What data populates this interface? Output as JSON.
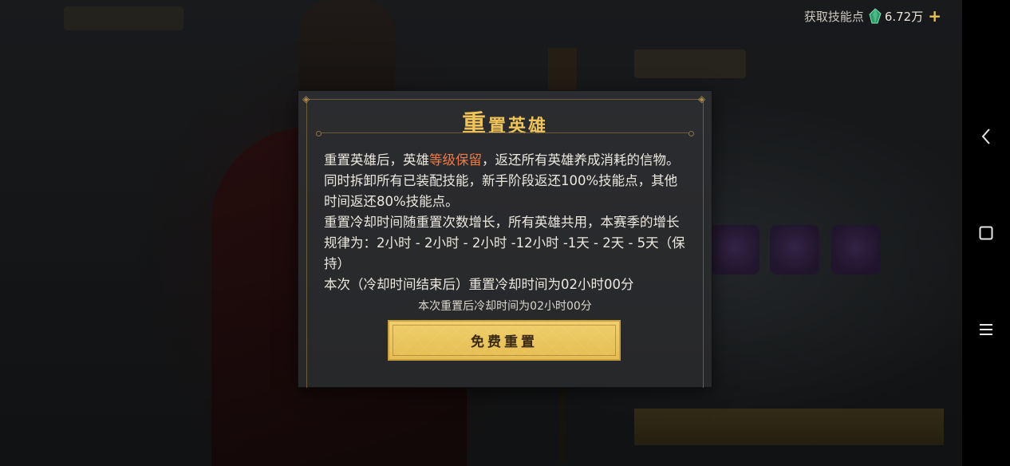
{
  "resource": {
    "label": "获取技能点",
    "amount": "6.72万",
    "plus": "+",
    "icon": "green-gem-icon"
  },
  "dialog": {
    "title_first": "重",
    "title_rest": "置英雄",
    "para1_a": "重置英雄后，英雄",
    "para1_hl": "等级保留",
    "para1_b": "，返还所有英雄养成消耗的信物。同时拆卸所有已装配技能，新手阶段返还100%技能点，其他时间返还80%技能点。",
    "para2": "重置冷却时间随重置次数增长，所有英雄共用，本赛季的增长规律为：2小时 - 2小时 - 2小时 -12小时 -1天 - 2天 - 5天（保持）",
    "para3": "本次（冷却时间结束后）重置冷却时间为02小时00分",
    "note": "本次重置后冷却时间为02小时00分",
    "button": "免费重置"
  },
  "colors": {
    "title": "#f0c45a",
    "highlight": "#ef7b43",
    "button": "#e5bd52"
  },
  "navbar": {
    "back": "back-icon",
    "home": "home-icon",
    "menu": "menu-icon"
  }
}
